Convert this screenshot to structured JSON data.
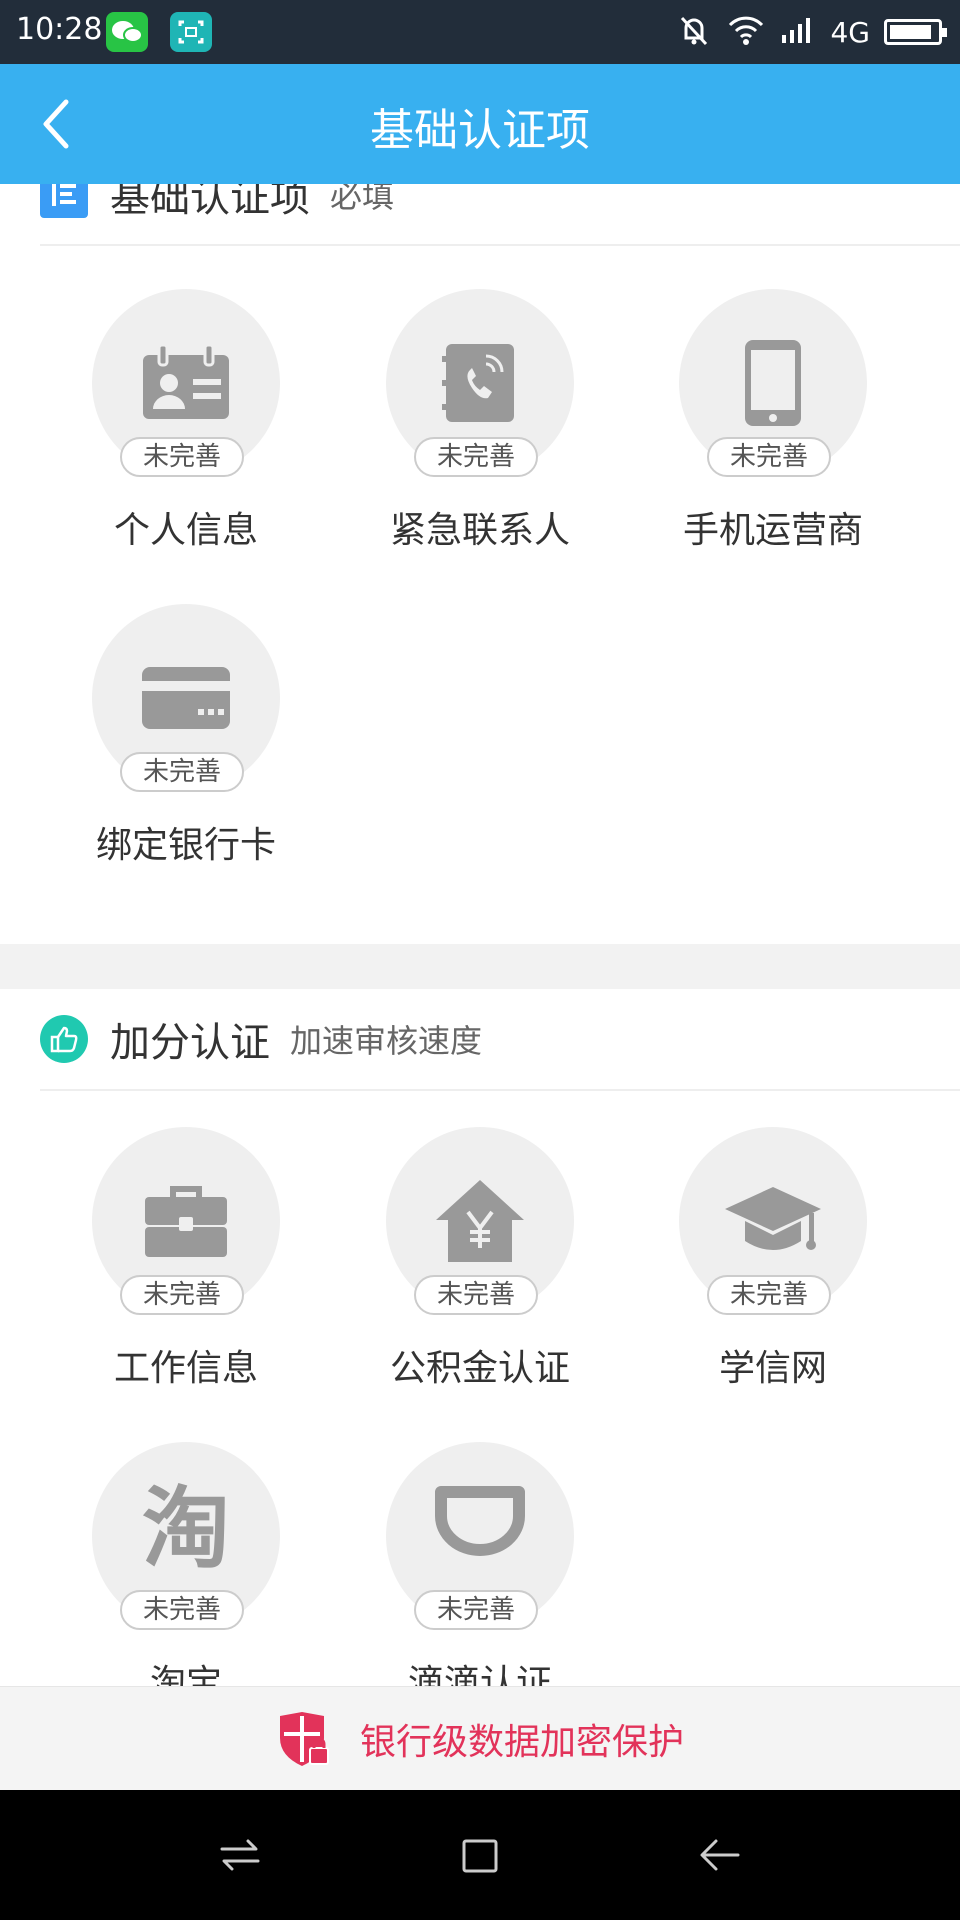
{
  "status_bar": {
    "time": "10:28",
    "network": "4G",
    "icons": [
      "wechat-icon",
      "scan-icon",
      "bell-off-icon",
      "wifi-icon",
      "signal-icon",
      "battery-icon"
    ],
    "battery_level": 0.9
  },
  "title_bar": {
    "title": "基础认证项",
    "back_icon": "chevron-left-icon"
  },
  "sections": {
    "basic": {
      "title": "基础认证项",
      "subtitle": "必填",
      "items": [
        {
          "label": "个人信息",
          "status": "未完善",
          "icon": "id-card-icon"
        },
        {
          "label": "紧急联系人",
          "status": "未完善",
          "icon": "contact-book-icon"
        },
        {
          "label": "手机运营商",
          "status": "未完善",
          "icon": "phone-icon"
        },
        {
          "label": "绑定银行卡",
          "status": "未完善",
          "icon": "bank-card-icon"
        }
      ]
    },
    "bonus": {
      "title": "加分认证",
      "subtitle": "加速审核速度",
      "items": [
        {
          "label": "工作信息",
          "status": "未完善",
          "icon": "briefcase-icon"
        },
        {
          "label": "公积金认证",
          "status": "未完善",
          "icon": "house-yuan-icon"
        },
        {
          "label": "学信网",
          "status": "未完善",
          "icon": "graduation-cap-icon"
        },
        {
          "label": "淘宝",
          "status": "未完善",
          "icon": "taobao-icon",
          "icon_glyph": "淘"
        },
        {
          "label": "滴滴认证",
          "status": "未完善",
          "icon": "didi-icon"
        }
      ]
    }
  },
  "footer": {
    "text": "银行级数据加密保护",
    "icon": "shield-lock-icon",
    "color": "#e2335a"
  },
  "nav_bar": {
    "icons": [
      "menu-icon",
      "home-icon",
      "back-icon"
    ]
  },
  "colors": {
    "title_bar": "#38b0f0",
    "status_bar": "#222d3a",
    "basic_accent": "#3a9cf5",
    "bonus_accent": "#20c9b0",
    "icon_gray": "#999999"
  }
}
